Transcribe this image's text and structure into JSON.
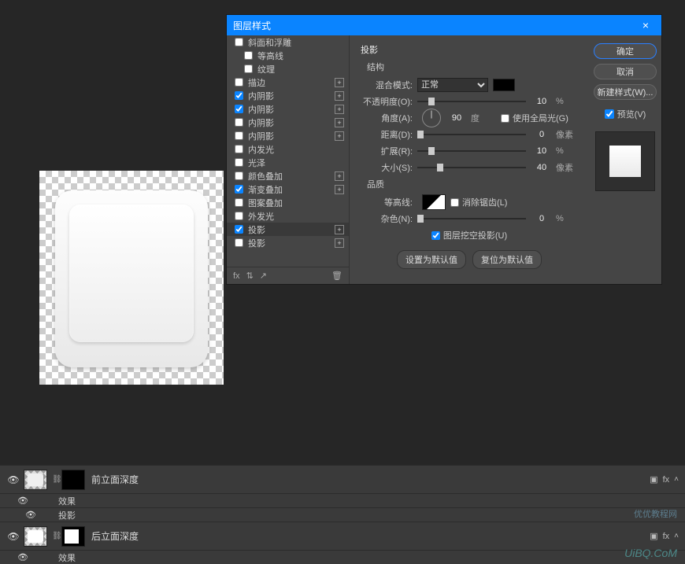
{
  "dialog": {
    "title": "图层样式",
    "close_label": "×",
    "effects": [
      {
        "label": "斜面和浮雕",
        "checked": false,
        "indent": 0,
        "plus": false
      },
      {
        "label": "等高线",
        "checked": false,
        "indent": 1,
        "plus": false
      },
      {
        "label": "纹理",
        "checked": false,
        "indent": 1,
        "plus": false
      },
      {
        "label": "描边",
        "checked": false,
        "indent": 0,
        "plus": true
      },
      {
        "label": "内阴影",
        "checked": true,
        "indent": 0,
        "plus": true
      },
      {
        "label": "内阴影",
        "checked": true,
        "indent": 0,
        "plus": true
      },
      {
        "label": "内阴影",
        "checked": false,
        "indent": 0,
        "plus": true
      },
      {
        "label": "内阴影",
        "checked": false,
        "indent": 0,
        "plus": true
      },
      {
        "label": "内发光",
        "checked": false,
        "indent": 0,
        "plus": false
      },
      {
        "label": "光泽",
        "checked": false,
        "indent": 0,
        "plus": false
      },
      {
        "label": "颜色叠加",
        "checked": false,
        "indent": 0,
        "plus": true
      },
      {
        "label": "渐变叠加",
        "checked": true,
        "indent": 0,
        "plus": true
      },
      {
        "label": "图案叠加",
        "checked": false,
        "indent": 0,
        "plus": false
      },
      {
        "label": "外发光",
        "checked": false,
        "indent": 0,
        "plus": false
      },
      {
        "label": "投影",
        "checked": true,
        "indent": 0,
        "plus": true,
        "selected": true
      },
      {
        "label": "投影",
        "checked": false,
        "indent": 0,
        "plus": true
      }
    ],
    "footer_fx": "fx",
    "section_title": "投影",
    "structure_title": "结构",
    "blend_mode_label": "混合模式:",
    "blend_mode_value": "正常",
    "opacity_label": "不透明度(O):",
    "opacity_value": "10",
    "opacity_unit": "%",
    "angle_label": "角度(A):",
    "angle_value": "90",
    "angle_unit": "度",
    "global_light_label": "使用全局光(G)",
    "global_light_checked": false,
    "distance_label": "距离(D):",
    "distance_value": "0",
    "distance_unit": "像素",
    "spread_label": "扩展(R):",
    "spread_value": "10",
    "spread_unit": "%",
    "size_label": "大小(S):",
    "size_value": "40",
    "size_unit": "像素",
    "quality_title": "品质",
    "contour_label": "等高线:",
    "antialias_label": "消除锯齿(L)",
    "antialias_checked": false,
    "noise_label": "杂色(N):",
    "noise_value": "0",
    "noise_unit": "%",
    "knockout_label": "图层挖空投影(U)",
    "knockout_checked": true,
    "make_default_label": "设置为默认值",
    "reset_default_label": "复位为默认值",
    "ok_label": "确定",
    "cancel_label": "取消",
    "new_style_label": "新建样式(W)...",
    "preview_label": "预览(V)"
  },
  "layers": {
    "layer1_name": "前立面深度",
    "layer2_name": "后立面深度",
    "effects_label": "效果",
    "drop_shadow_label": "投影",
    "fx_label": "fx"
  },
  "watermark": "UiBQ.CoM",
  "watermark2": "优优教程网"
}
